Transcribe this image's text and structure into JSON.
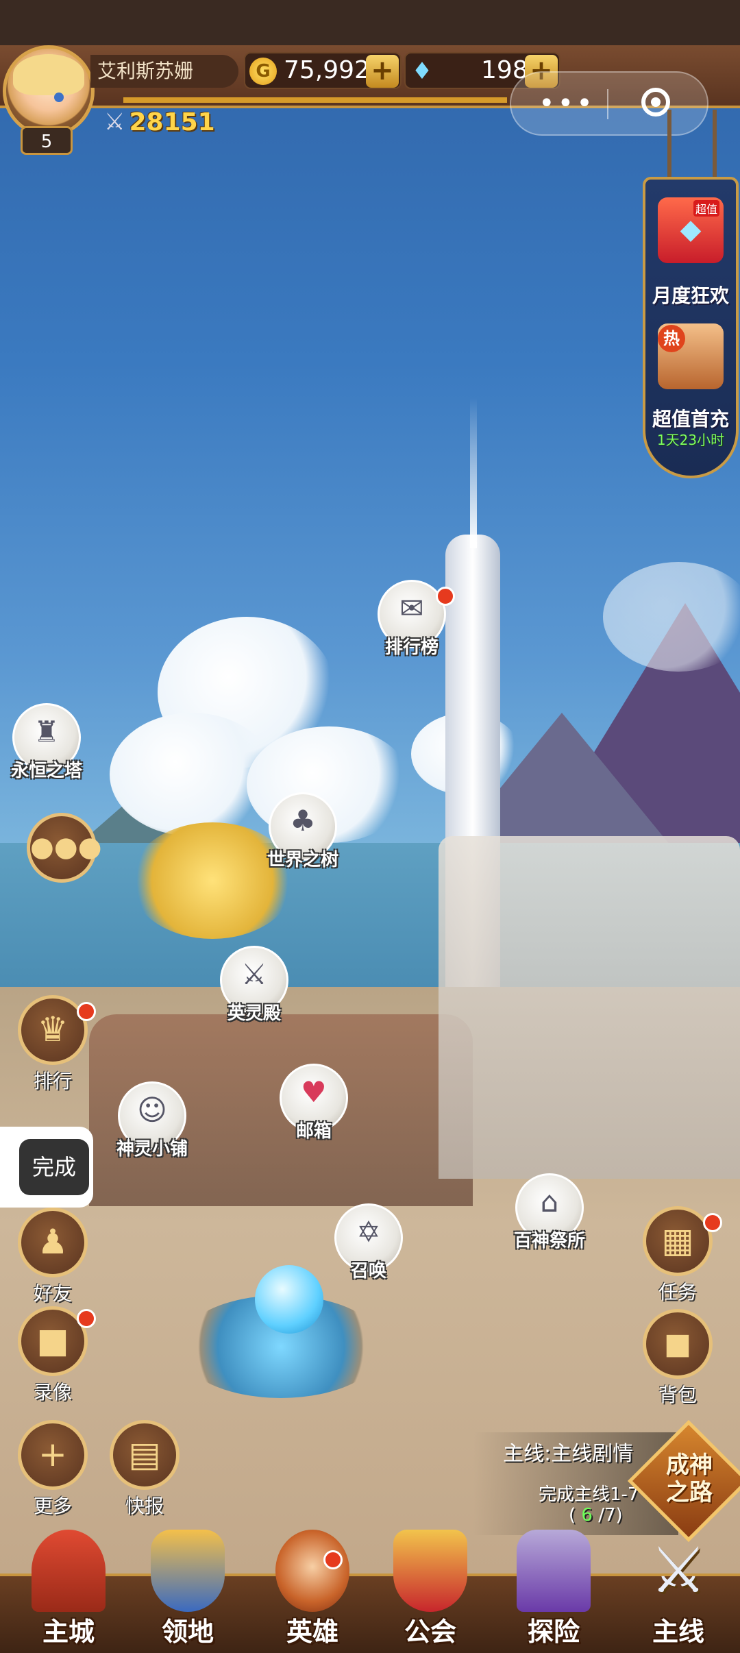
{
  "player": {
    "name": "艾利斯苏姗",
    "level": "5",
    "power": "28151"
  },
  "resources": {
    "gold": "75,992",
    "gems": "198",
    "gold_icon": "G"
  },
  "mini_program_menu": {
    "more_icon": "•••",
    "close_icon": "target-icon"
  },
  "events": {
    "monthly": "月度狂欢",
    "monthly_badge": "超值",
    "first_charge": "超值首充",
    "first_charge_hot": "热",
    "timer": "1天23小时"
  },
  "map_locations": {
    "leaderboard": "排行榜",
    "eternal_tower": "永恒之塔",
    "world_tree": "世界之树",
    "hero_hall": "英灵殿",
    "mailbox": "邮箱",
    "spirit_shop": "神灵小铺",
    "gods_shrine": "百神祭所",
    "summon": "召唤"
  },
  "side_buttons": {
    "rank": "排行",
    "friends": "好友",
    "replay": "录像",
    "more": "更多",
    "news": "快报",
    "tasks": "任务",
    "bag": "背包"
  },
  "done_button": "完成",
  "quest": {
    "title": "主线:主线剧情",
    "task": "完成主线1-7",
    "progress_open": "(",
    "progress_current": "6",
    "progress_rest": "/7)",
    "road_line1": "成神",
    "road_line2": "之路"
  },
  "bottom_nav": {
    "city": "主城",
    "territory": "领地",
    "heroes": "英雄",
    "guild": "公会",
    "explore": "探险",
    "mainline": "主线"
  },
  "colors": {
    "hud_brown": "#5a3420",
    "gold_trim": "#c9953e",
    "notify_red": "#e63a1e"
  }
}
